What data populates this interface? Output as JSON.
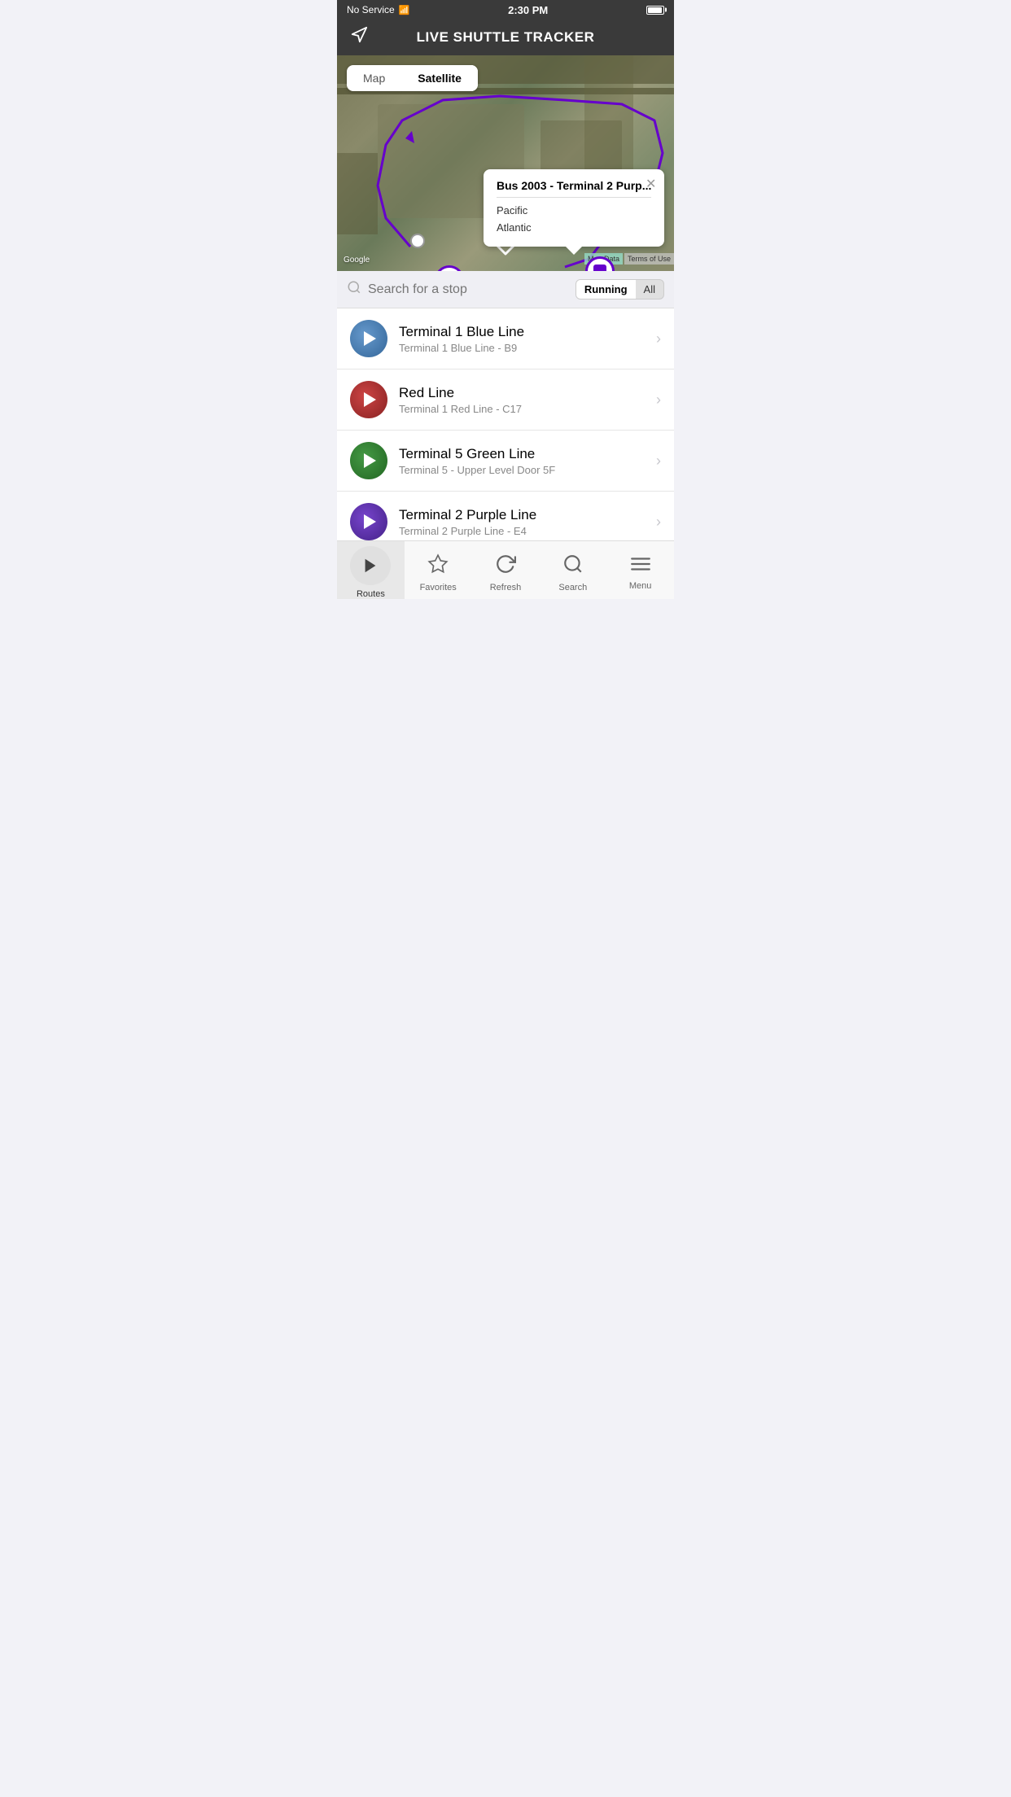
{
  "statusBar": {
    "carrier": "No Service",
    "time": "2:30 PM"
  },
  "header": {
    "title": "LIVE SHUTTLE TRACKER",
    "iconLabel": "location-arrow-icon"
  },
  "mapToggle": {
    "mapLabel": "Map",
    "satelliteLabel": "Satellite",
    "activeTab": "Satellite"
  },
  "infoPopup": {
    "title": "Bus 2003 - Terminal 2 Purp...",
    "lines": [
      "Pacific",
      "Atlantic"
    ]
  },
  "map": {
    "googleLabel": "Google",
    "mapDataLabel": "Map Data",
    "termsLabel": "Terms of Use"
  },
  "search": {
    "placeholder": "Search for a stop",
    "filterRunning": "Running",
    "filterAll": "All"
  },
  "routes": [
    {
      "name": "Terminal 1 Blue Line",
      "sub": "Terminal 1 Blue Line - B9",
      "color": "blue"
    },
    {
      "name": "Red Line",
      "sub": "Terminal 1 Red Line - C17",
      "color": "red"
    },
    {
      "name": "Terminal 5 Green Line",
      "sub": "Terminal 5 - Upper Level Door 5F",
      "color": "green"
    },
    {
      "name": "Terminal 2 Purple Line",
      "sub": "Terminal 2 Purple Line - E4",
      "color": "purple"
    }
  ],
  "tabBar": {
    "tabs": [
      {
        "label": "Routes",
        "icon": "▶",
        "active": true
      },
      {
        "label": "Favorites",
        "icon": "☆",
        "active": false
      },
      {
        "label": "Refresh",
        "icon": "↺",
        "active": false
      },
      {
        "label": "Search",
        "icon": "⌕",
        "active": false
      },
      {
        "label": "Menu",
        "icon": "≡",
        "active": false
      }
    ]
  }
}
